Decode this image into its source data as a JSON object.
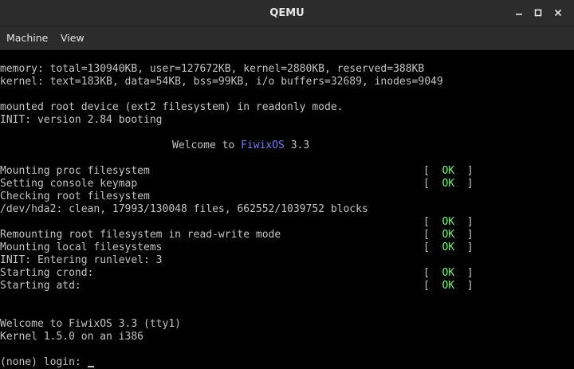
{
  "window": {
    "title": "QEMU",
    "controls": {
      "minimize": "–",
      "maximize": "□",
      "close": "×"
    }
  },
  "menubar": {
    "items": [
      "Machine",
      "View"
    ]
  },
  "terminal": {
    "memory_line": "memory: total=130940KB, user=127672KB, kernel=2880KB, reserved=388KB",
    "kernel_line": "kernel: text=183KB, data=54KB, bss=99KB, i/o buffers=32689, inodes=9049",
    "mounted_line": "mounted root device (ext2 filesystem) in readonly mode.",
    "init_line": "INIT: version 2.84 booting",
    "welcome": {
      "prefix": "Welcome to ",
      "fiwix": "Fiwix",
      "os": "OS",
      "version": " 3.3"
    },
    "status_open": "[  ",
    "status_ok": "OK",
    "status_close": "  ]",
    "boot_lines": {
      "mount_proc": "Mounting proc filesystem",
      "console_keymap": "Setting console keymap",
      "check_root": "Checking root filesystem",
      "hda2": "/dev/hda2: clean, 17993/130048 files, 662552/1039752 blocks",
      "remount": "Remounting root filesystem in read-write mode",
      "mount_local": "Mounting local filesystems",
      "runlevel": "INIT: Entering runlevel: 3",
      "crond": "Starting crond:",
      "atd": "Starting atd:"
    },
    "welcome_tty": "Welcome to FiwixOS 3.3 (tty1)",
    "kernel_version": "Kernel 1.5.0 on an i386",
    "login_prompt": "(none) login: "
  },
  "colors": {
    "background": "#000000",
    "text": "#c4c4c4",
    "ok": "#6cff6c",
    "fiwix_blue": "#7b7bff",
    "titlebar": "#2c2c2c"
  }
}
